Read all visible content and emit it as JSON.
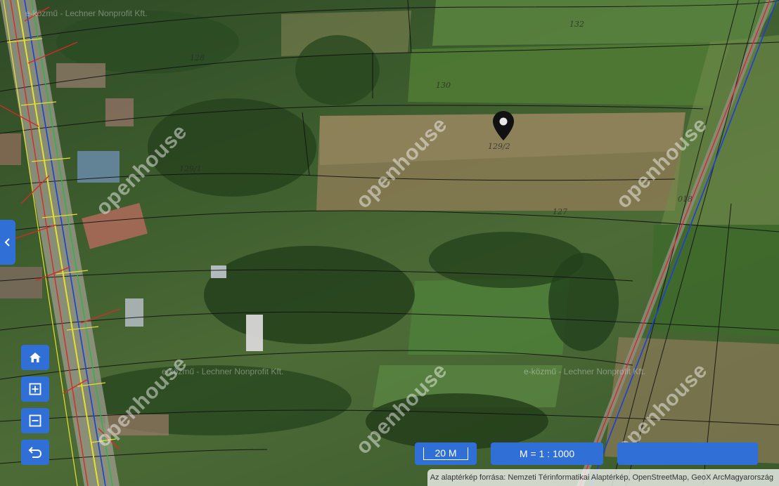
{
  "map": {
    "parcel_labels": [
      "129/2",
      "127",
      "129/1",
      "130",
      "132",
      "128",
      "018"
    ],
    "watermark_text": "openhouse",
    "credit_overlay": [
      "e-közmű - Lechner Nonprofit Kft.",
      "e-közmű - Lechner Nonprofit Kft.",
      "e-közmű - Lechner Nonprofit Kft."
    ],
    "marker_icon": "location-pin-icon"
  },
  "controls": {
    "side_toggle_icon": "chevron-left-icon",
    "home_icon": "home-icon",
    "zoom_in_icon": "zoom-in-icon",
    "zoom_out_icon": "zoom-out-icon",
    "back_icon": "undo-icon"
  },
  "scale": {
    "bar_label": "20 M",
    "ratio_label": "M = 1 : 1000",
    "empty_box_label": ""
  },
  "attribution": "Az alaptérkép forrása: Nemzeti Térinformatikai Alaptérkép, OpenStreetMap, GeoX ArcMagyarország",
  "colors": {
    "accent": "#2f6fd6",
    "marker": "#111111",
    "road_line_red": "#d42a2a",
    "road_line_blue": "#1c3fd8",
    "utility_yellow": "#e8e02a",
    "utility_green": "#2fb24a"
  }
}
